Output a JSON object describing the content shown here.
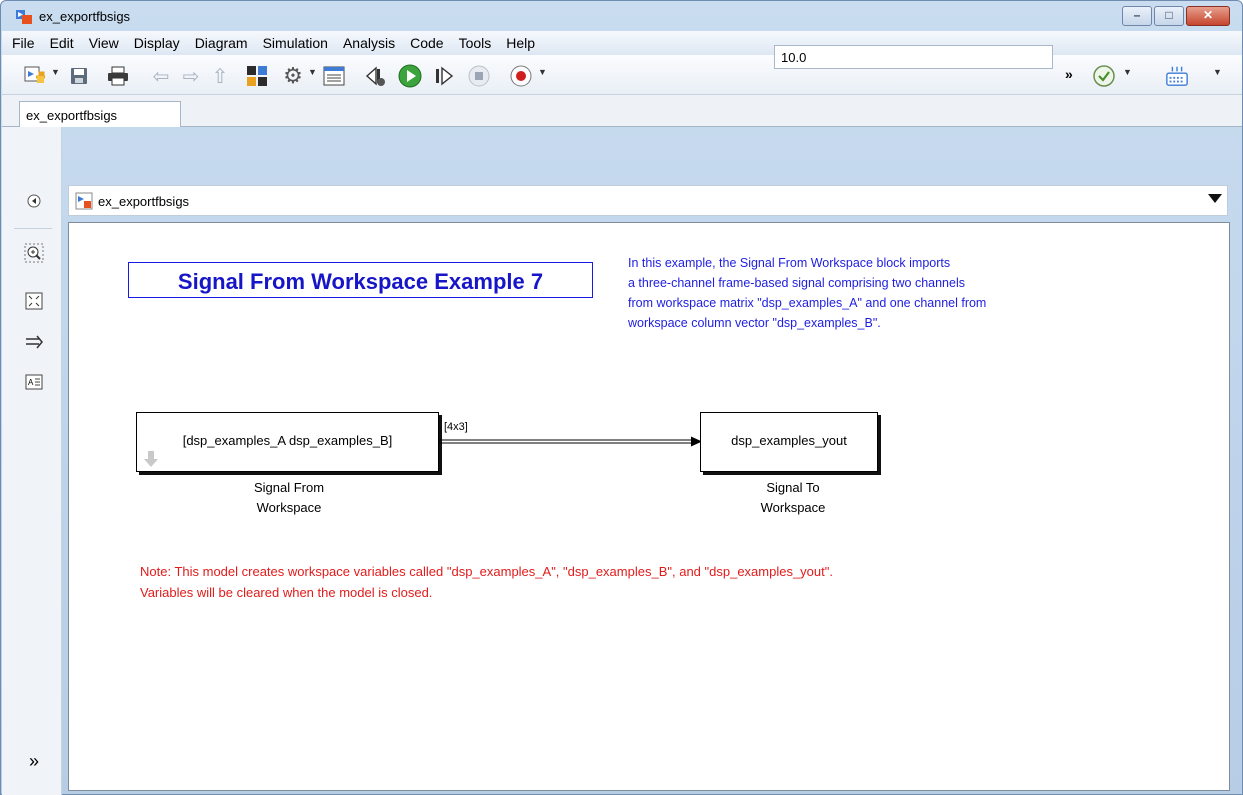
{
  "window": {
    "title": "ex_exportfbsigs",
    "buttons": {
      "minimize": "–",
      "maximize": "□",
      "close": "✕"
    }
  },
  "menubar": {
    "items": [
      "File",
      "Edit",
      "View",
      "Display",
      "Diagram",
      "Simulation",
      "Analysis",
      "Code",
      "Tools",
      "Help"
    ]
  },
  "toolbar": {
    "stop_time": "10.0",
    "more": "»"
  },
  "tabs": [
    {
      "label": "ex_exportfbsigs"
    }
  ],
  "breadcrumb": {
    "model": "ex_exportfbsigs"
  },
  "palette": {
    "expand": "»"
  },
  "diagram": {
    "title": "Signal From Workspace Example 7",
    "info_lines": [
      "In this example, the Signal From Workspace block imports",
      "a three-channel frame-based signal comprising two channels",
      "from workspace matrix \"dsp_examples_A\" and one channel from",
      "workspace column vector \"dsp_examples_B\"."
    ],
    "source_block": {
      "label": "[dsp_examples_A dsp_examples_B]",
      "caption_line1": "Signal From",
      "caption_line2": "Workspace"
    },
    "sink_block": {
      "label": "dsp_examples_yout",
      "caption_line1": "Signal To",
      "caption_line2": "Workspace"
    },
    "signal_dimension": "[4x3]",
    "note_lines": [
      "Note: This model creates workspace variables called \"dsp_examples_A\", \"dsp_examples_B\", and \"dsp_examples_yout\".",
      "Variables will be cleared when the model is closed."
    ]
  },
  "colors": {
    "title_blue": "#1616c8",
    "info_blue": "#1e1ee0",
    "note_red": "#e21b1b",
    "run_green": "#3ca43c"
  }
}
